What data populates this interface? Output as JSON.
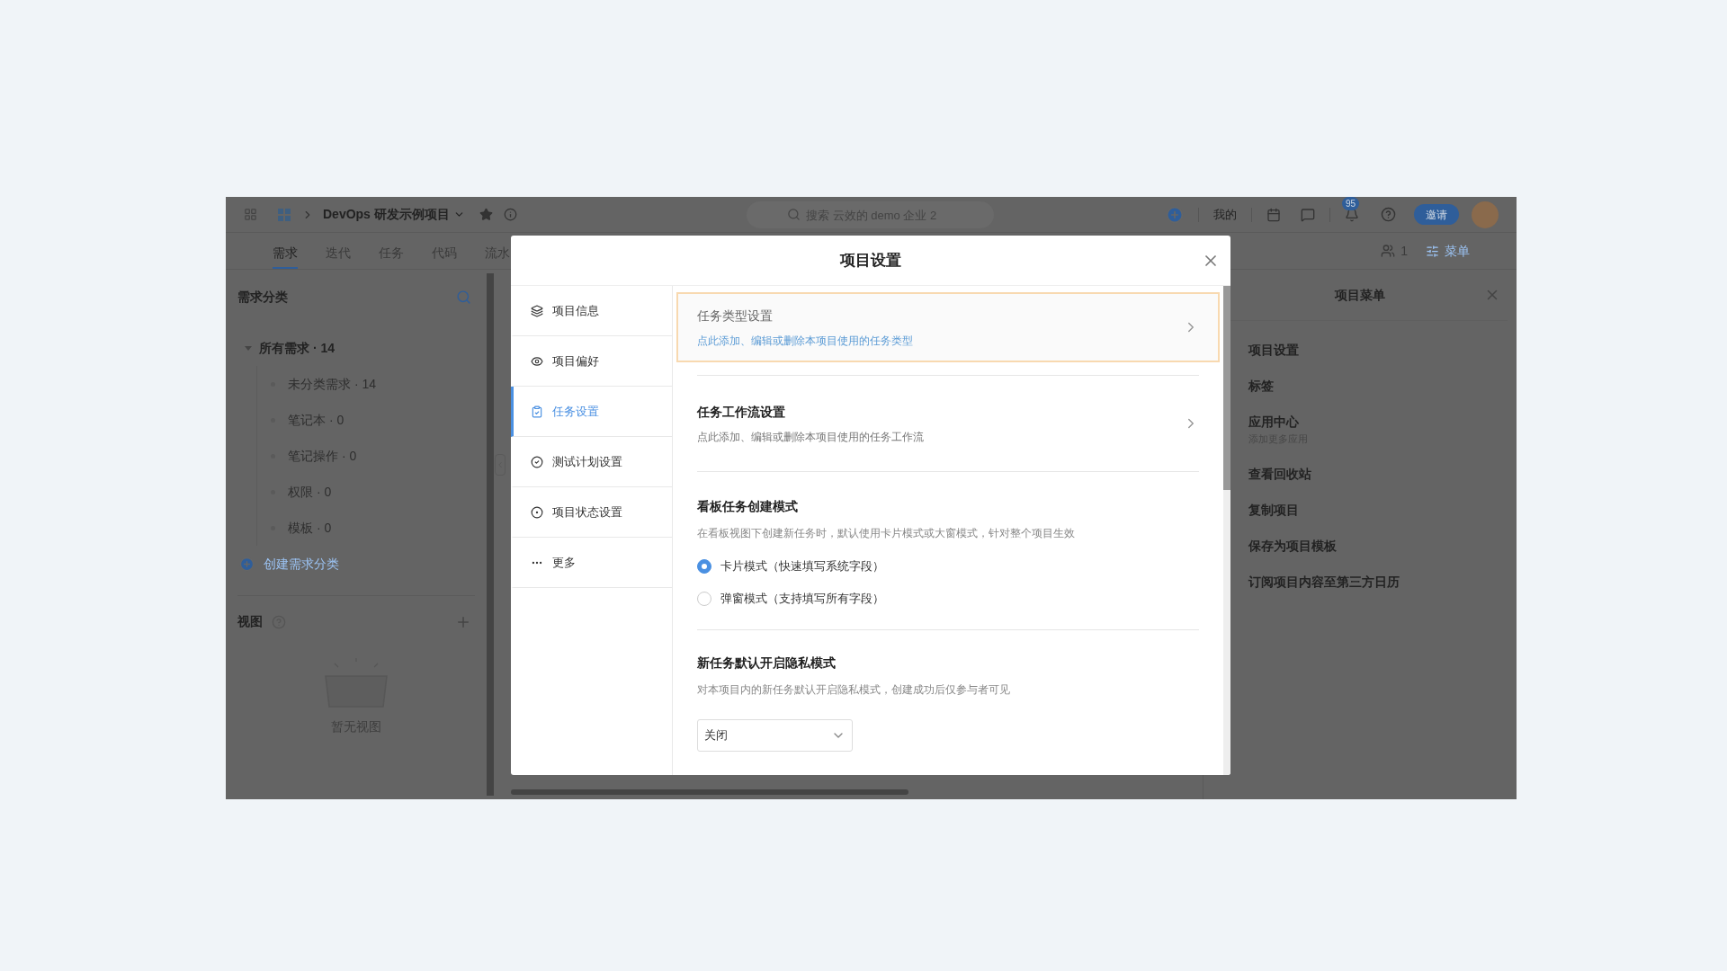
{
  "topbar": {
    "project": "DevOps 研发示例项目",
    "search_placeholder": "搜索 云效的 demo 企业 2",
    "mine": "我的",
    "notification_count": "95",
    "invite": "邀请"
  },
  "tabs": [
    {
      "label": "需求",
      "selected": true
    },
    {
      "label": "迭代",
      "selected": false
    },
    {
      "label": "任务",
      "selected": false
    },
    {
      "label": "代码",
      "selected": false
    },
    {
      "label": "流水",
      "selected": false
    }
  ],
  "tabbar_right": {
    "members_count": "1",
    "menu_label": "菜单"
  },
  "categories": {
    "title": "需求分类",
    "tree": [
      {
        "label": "所有需求 · 14",
        "expanded": true,
        "children": [
          {
            "label": "未分类需求 · 14"
          },
          {
            "label": "笔记本 · 0"
          },
          {
            "label": "笔记操作 · 0"
          },
          {
            "label": "权限 · 0"
          },
          {
            "label": "模板 · 0"
          }
        ]
      }
    ],
    "create_link": "创建需求分类"
  },
  "views": {
    "title": "视图",
    "empty_text": "暂无视图"
  },
  "project_menu": {
    "title": "项目菜单",
    "items": [
      {
        "label": "项目设置"
      },
      {
        "label": "标签"
      },
      {
        "label": "应用中心",
        "sublabel": "添加更多应用"
      },
      {
        "label": "查看回收站"
      },
      {
        "label": "复制项目"
      },
      {
        "label": "保存为项目模板"
      },
      {
        "label": "订阅项目内容至第三方日历"
      }
    ]
  },
  "modal": {
    "title": "项目设置",
    "nav": [
      {
        "label": "项目信息",
        "selected": false
      },
      {
        "label": "项目偏好",
        "selected": false
      },
      {
        "label": "任务设置",
        "selected": true
      },
      {
        "label": "测试计划设置",
        "selected": false
      },
      {
        "label": "项目状态设置",
        "selected": false
      },
      {
        "label": "更多",
        "selected": false
      }
    ],
    "sections": [
      {
        "kind": "link",
        "title": "任务类型设置",
        "description": "点此添加、编辑或删除本项目使用的任务类型",
        "highlighted": true
      },
      {
        "kind": "link",
        "title": "任务工作流设置",
        "description": "点此添加、编辑或删除本项目使用的任务工作流",
        "highlighted": false
      },
      {
        "kind": "radio",
        "title": "看板任务创建模式",
        "description": "在看板视图下创建新任务时，默认使用卡片模式或大窗模式，针对整个项目生效",
        "options": [
          {
            "label": "卡片模式（快速填写系统字段）",
            "selected": true
          },
          {
            "label": "弹窗模式（支持填写所有字段）",
            "selected": false
          }
        ]
      },
      {
        "kind": "select",
        "title": "新任务默认开启隐私模式",
        "description": "对本项目内的新任务默认开启隐私模式，创建成功后仅参与者可见",
        "value": "关闭"
      }
    ]
  }
}
